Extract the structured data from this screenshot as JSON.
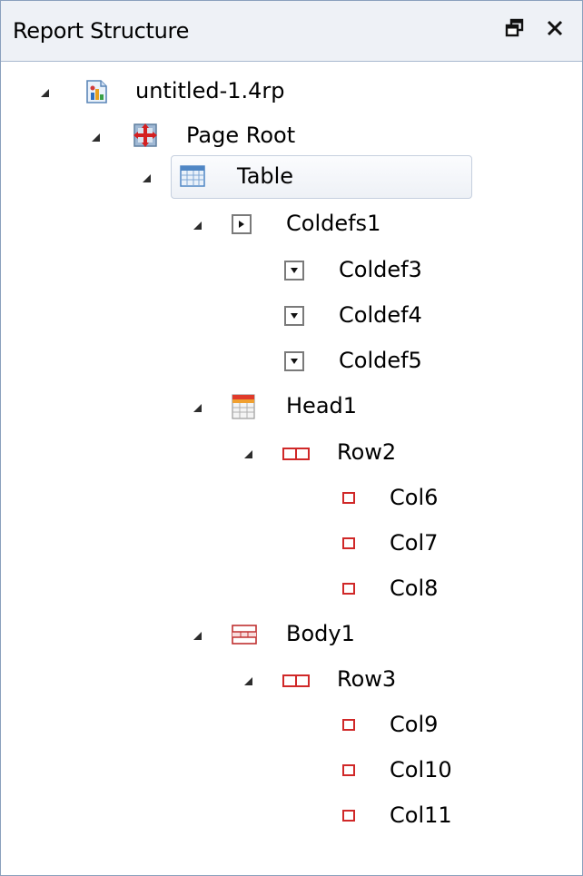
{
  "panel": {
    "title": "Report Structure",
    "restore_icon": "restore-window-icon",
    "close_icon": "close-icon"
  },
  "tree": {
    "nodes": [
      {
        "label": "untitled-1.4rp",
        "icon": "report-file-icon",
        "expanded": true
      },
      {
        "label": "Page Root",
        "icon": "page-root-icon",
        "expanded": true
      },
      {
        "label": "Table",
        "icon": "table-icon",
        "expanded": true,
        "selected": true
      },
      {
        "label": "Coldefs1",
        "icon": "coldefs-icon",
        "expanded": true
      },
      {
        "label": "Coldef3",
        "icon": "coldef-icon"
      },
      {
        "label": "Coldef4",
        "icon": "coldef-icon"
      },
      {
        "label": "Coldef5",
        "icon": "coldef-icon"
      },
      {
        "label": "Head1",
        "icon": "table-header-icon",
        "expanded": true
      },
      {
        "label": "Row2",
        "icon": "row-icon",
        "expanded": true
      },
      {
        "label": "Col6",
        "icon": "cell-icon"
      },
      {
        "label": "Col7",
        "icon": "cell-icon"
      },
      {
        "label": "Col8",
        "icon": "cell-icon"
      },
      {
        "label": "Body1",
        "icon": "table-body-icon",
        "expanded": true
      },
      {
        "label": "Row3",
        "icon": "row-icon",
        "expanded": true
      },
      {
        "label": "Col9",
        "icon": "cell-icon"
      },
      {
        "label": "Col10",
        "icon": "cell-icon"
      },
      {
        "label": "Col11",
        "icon": "cell-icon"
      }
    ]
  }
}
